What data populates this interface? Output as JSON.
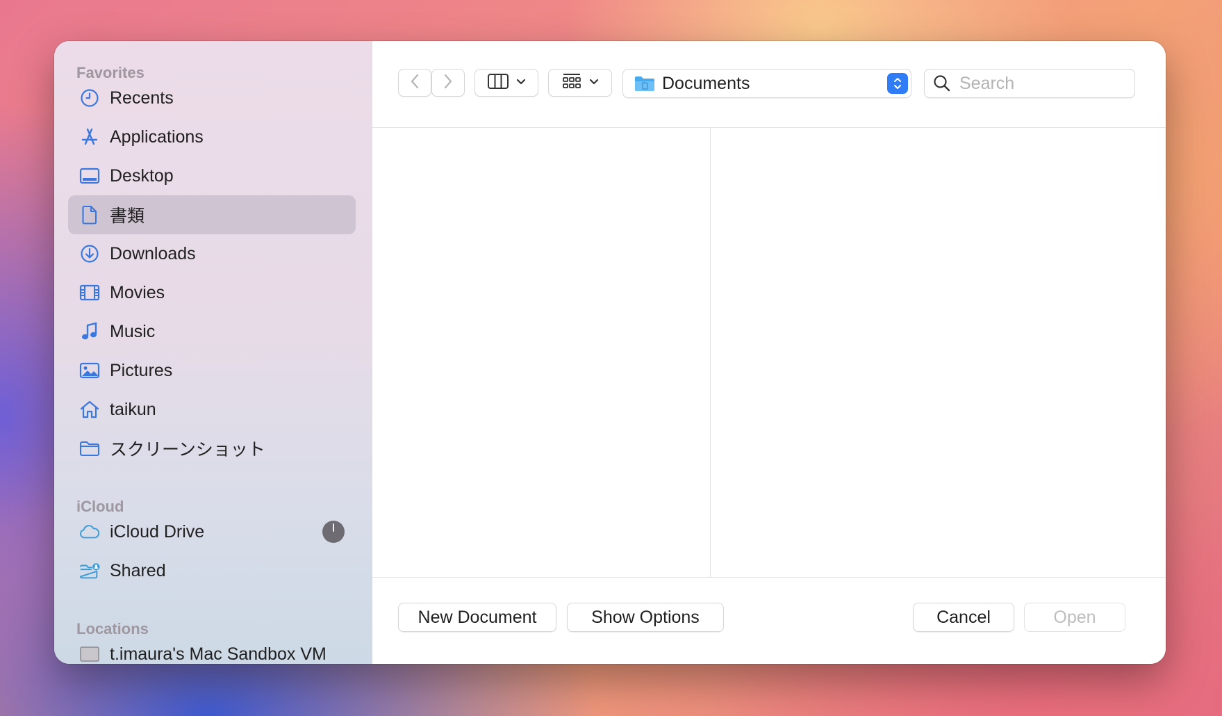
{
  "sidebar": {
    "favorites_header": "Favorites",
    "favorites": [
      {
        "label": "Recents",
        "icon": "clock-icon"
      },
      {
        "label": "Applications",
        "icon": "apps-icon"
      },
      {
        "label": "Desktop",
        "icon": "desktop-icon"
      },
      {
        "label": "書類",
        "icon": "document-icon",
        "selected": true
      },
      {
        "label": "Downloads",
        "icon": "download-icon"
      },
      {
        "label": "Movies",
        "icon": "film-icon"
      },
      {
        "label": "Music",
        "icon": "music-note-icon"
      },
      {
        "label": "Pictures",
        "icon": "photo-icon"
      },
      {
        "label": "taikun",
        "icon": "home-icon"
      },
      {
        "label": "スクリーンショット",
        "icon": "folder-icon"
      }
    ],
    "icloud_header": "iCloud",
    "icloud": [
      {
        "label": "iCloud Drive",
        "icon": "cloud-icon"
      },
      {
        "label": "Shared",
        "icon": "shared-folder-icon"
      }
    ],
    "locations_header": "Locations",
    "locations": [
      {
        "label": "t.imaura's Mac Sandbox VM",
        "icon": "computer-icon"
      }
    ]
  },
  "toolbar": {
    "location_name": "Documents",
    "search_placeholder": "Search"
  },
  "footer": {
    "new_document": "New Document",
    "show_options": "Show Options",
    "cancel": "Cancel",
    "open": "Open"
  },
  "colors": {
    "accent": "#2f7cf6",
    "icon_blue": "#3a78e0",
    "selection": "#cfc4d1"
  }
}
